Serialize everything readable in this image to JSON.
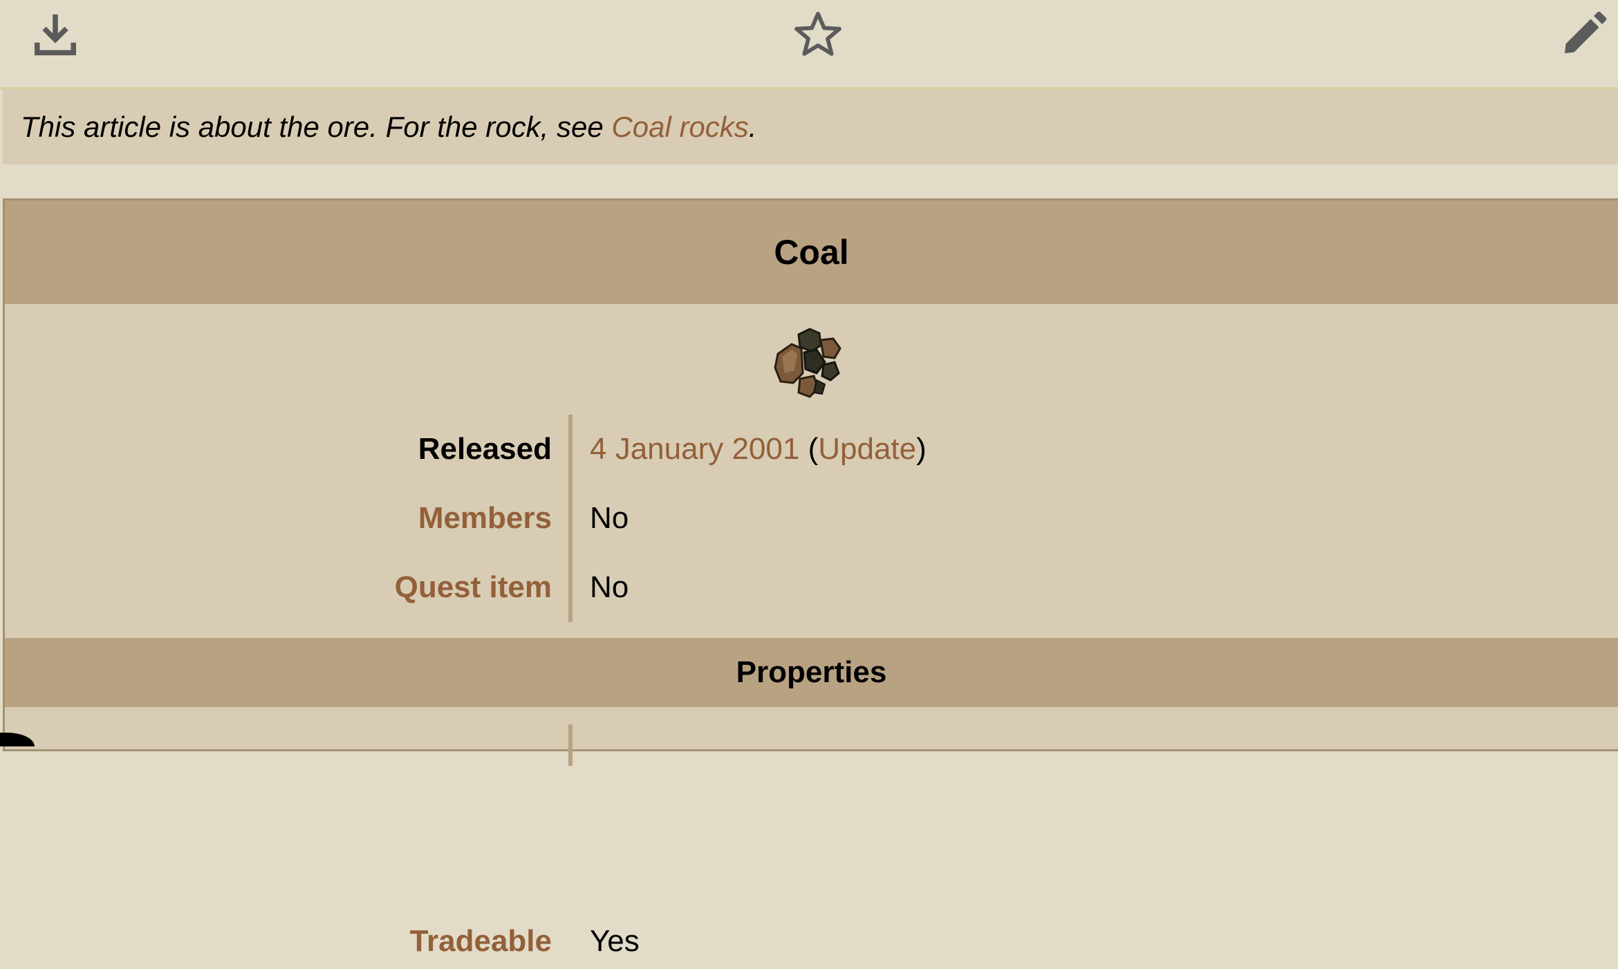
{
  "toolbar": {
    "download_icon": "download-icon",
    "star_icon": "star-outline-icon",
    "edit_icon": "pencil-icon",
    "icon_color": "#5b5b5b"
  },
  "hatnote": {
    "prefix": "This article is about the ore. For the rock, see ",
    "link": "Coal rocks",
    "suffix": "."
  },
  "infobox": {
    "title": "Coal",
    "image_icon": "coal-ore-icon",
    "rows": [
      {
        "label": "Released",
        "value_link": "4 January 2001",
        "value_open": " (",
        "value_link2": "Update",
        "value_close": ")"
      },
      {
        "label": "Members",
        "value": "No"
      },
      {
        "label": "Quest item",
        "value": "No"
      }
    ],
    "section": "Properties",
    "partial_row": {
      "label": "Tradeable",
      "value": "Yes"
    }
  },
  "colors": {
    "page_bg": "#e2dbc8",
    "hatnote_bg": "#d8ccb4",
    "header_bg": "#b8a282",
    "link": "#936039"
  }
}
